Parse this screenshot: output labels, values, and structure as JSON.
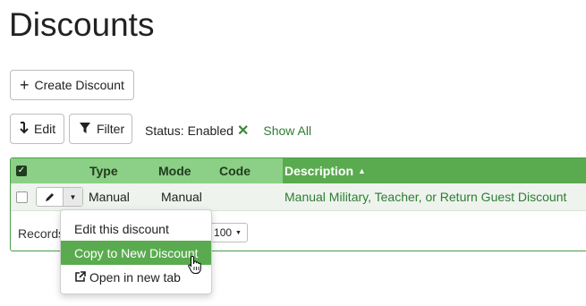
{
  "page": {
    "title": "Discounts"
  },
  "toolbar": {
    "create_label": "Create Discount",
    "edit_label": "Edit",
    "filter_label": "Filter",
    "status_label": "Status:",
    "status_value": "Enabled",
    "show_all_label": "Show All"
  },
  "table": {
    "headers": {
      "type": "Type",
      "mode": "Mode",
      "code": "Code",
      "description": "Description"
    },
    "sort": {
      "column": "description",
      "direction": "ascending"
    },
    "rows": [
      {
        "type": "Manual",
        "mode": "Manual",
        "code": "",
        "description": "Manual Military, Teacher, or Return Guest Discount"
      }
    ],
    "footer": {
      "records_label": "Records",
      "page_size": "100"
    }
  },
  "row_menu": {
    "items": [
      {
        "label": "Edit this discount",
        "active": false
      },
      {
        "label": "Copy to New Discount",
        "active": true
      },
      {
        "label": "Open in new tab",
        "active": false
      }
    ]
  },
  "colors": {
    "accent": "#5aab4f",
    "header_light": "#8ccf86",
    "link": "#2e7d32"
  },
  "icons": [
    "plus-icon",
    "edit-arrow-icon",
    "filter-icon",
    "close-icon",
    "sort-asc-icon",
    "pencil-icon",
    "caret-down-icon",
    "external-link-icon",
    "hand-cursor-icon"
  ]
}
